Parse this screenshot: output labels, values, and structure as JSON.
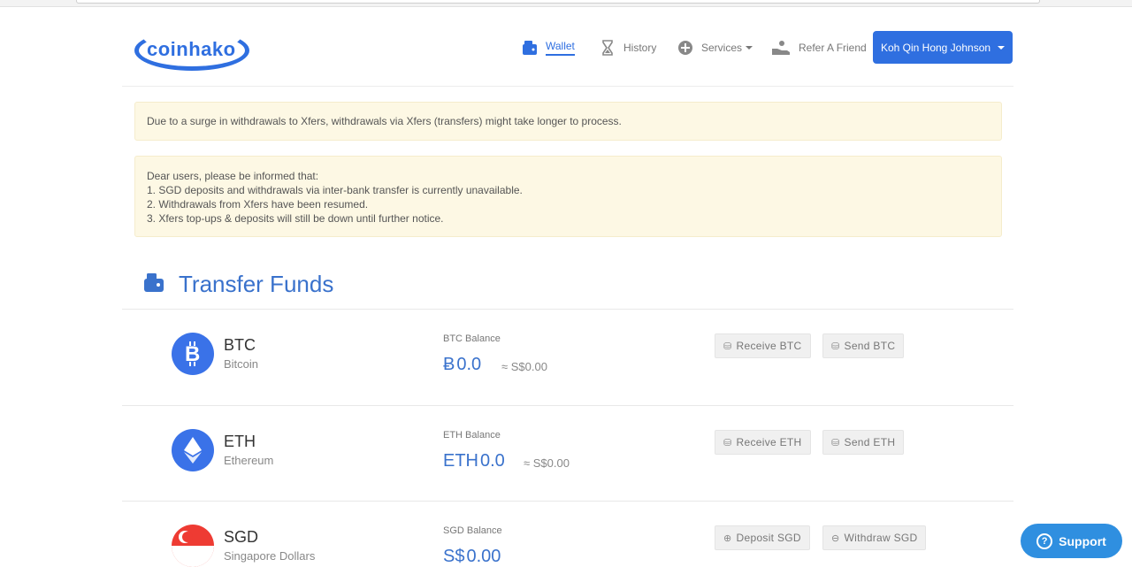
{
  "brand": {
    "logo_text": "coinhako",
    "accent": "#2f6fe0"
  },
  "nav": {
    "wallet": "Wallet",
    "history": "History",
    "services": "Services",
    "refer": "Refer A Friend",
    "user": "Koh Qin Hong Johnson"
  },
  "alerts": {
    "surge": "Due to a surge in withdrawals to Xfers, withdrawals via Xfers (transfers) might take longer to process.",
    "notice_lines": [
      "Dear users, please be informed that:",
      "1. SGD deposits and withdrawals via inter-bank transfer is currently unavailable.",
      "2. Withdrawals from Xfers have been resumed.",
      "3. Xfers top-ups & deposits will still be down until further notice."
    ]
  },
  "section": {
    "title": "Transfer Funds"
  },
  "assets": [
    {
      "symbol": "BTC",
      "name": "Bitcoin",
      "balance_label": "BTC Balance",
      "unit": "Ƀ",
      "amount": "0.0",
      "fiat": "≈ S$0.00",
      "btn1": "Receive BTC",
      "btn2": "Send BTC",
      "color": "#3a72e8"
    },
    {
      "symbol": "ETH",
      "name": "Ethereum",
      "balance_label": "ETH Balance",
      "unit": "ETH",
      "amount": "0.0",
      "fiat": "≈ S$0.00",
      "btn1": "Receive ETH",
      "btn2": "Send ETH",
      "color": "#3a72e8"
    },
    {
      "symbol": "SGD",
      "name": "Singapore Dollars",
      "balance_label": "SGD Balance",
      "unit": "S$",
      "amount": "0.00",
      "fiat": "",
      "btn1": "Deposit SGD",
      "btn2": "Withdraw SGD",
      "color": "#ee3b33"
    }
  ],
  "support": {
    "label": "Support"
  }
}
